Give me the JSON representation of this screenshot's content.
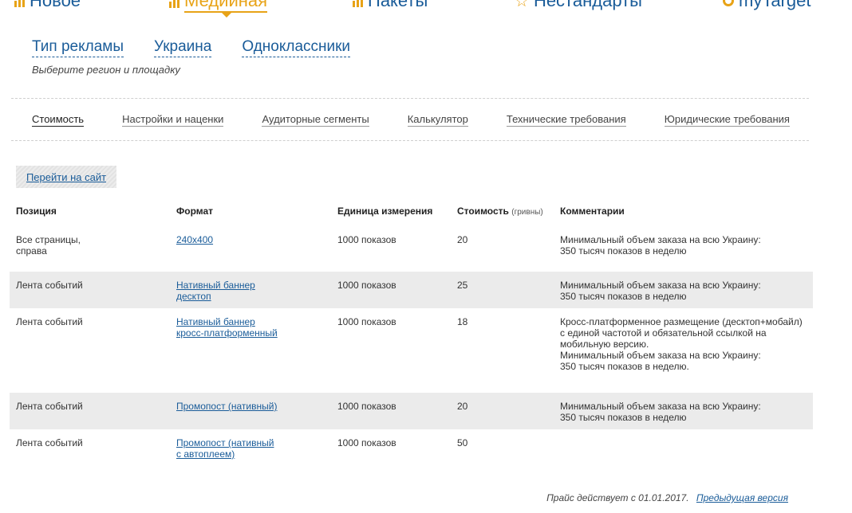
{
  "topnav": {
    "items": [
      {
        "label": "Новое",
        "icon": "bar-chart-icon"
      },
      {
        "label": "Медийная",
        "icon": "bar-chart-icon"
      },
      {
        "label": "Пакеты",
        "icon": "bar-chart-icon"
      },
      {
        "label": "Нестандарты",
        "icon": "star-icon"
      },
      {
        "label": "myTarget",
        "icon": "target-icon"
      }
    ],
    "accent_color": "#e8a317",
    "link_color": "#1a5c99"
  },
  "selectors": {
    "ad_type": "Тип рекламы",
    "region": "Украина",
    "site": "Одноклассники",
    "hint": "Выберите регион и площадку"
  },
  "subtabs": [
    "Стоимость",
    "Настройки и наценки",
    "Аудиторные сегменты",
    "Калькулятор",
    "Технические требования",
    "Юридические требования"
  ],
  "go_button": "Перейти на сайт",
  "table": {
    "headers": {
      "position": "Позиция",
      "format": "Формат",
      "unit": "Единица измерения",
      "price": "Стоимость",
      "price_note": "(гривны)",
      "comments": "Комментарии"
    },
    "rows": [
      {
        "position": "Все страницы,\nсправа",
        "format": "240x400",
        "unit": "1000 показов",
        "price": "20",
        "comment": "Минимальный объем заказа на всю Украину:\n350 тысяч показов в неделю"
      },
      {
        "position": "Лента событий",
        "format": "Нативный баннер \nдесктоп",
        "unit": "1000 показов",
        "price": "25",
        "comment": "Минимальный объем заказа на всю Украину:\n350 тысяч показов в неделю"
      },
      {
        "position": "Лента событий",
        "format": "Нативный баннер\nкросс-платформенный",
        "unit": "1000 показов",
        "price": "18",
        "comment": "Кросс-платформенное размещение (десктоп+мобайл)\nс единой частотой и обязательной ссылкой на\nмобильную версию.\nМинимальный объем заказа на всю Украину:\n350 тысяч показов в неделю."
      },
      {
        "position": "Лента событий",
        "format": "Промопост (нативный)",
        "unit": "1000 показов",
        "price": "20",
        "comment": "Минимальный объем заказа на всю Украину:\n350 тысяч показов в неделю"
      },
      {
        "position": "Лента событий",
        "format": "Промопост (нативный\nс автоплеем)",
        "unit": "1000 показов",
        "price": "50",
        "comment": ""
      }
    ]
  },
  "footer": {
    "note": "Прайс действует с 01.01.2017.",
    "prev_link": "Предыдущая версия"
  }
}
